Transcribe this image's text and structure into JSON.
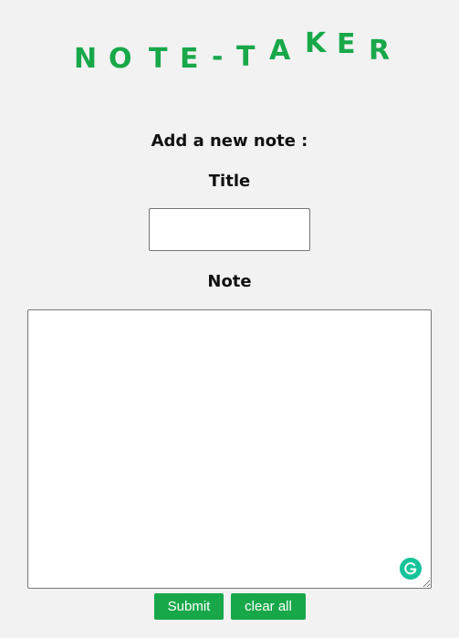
{
  "app": {
    "logo_letters": [
      "N",
      "O",
      "T",
      "E",
      "-",
      "T",
      "A",
      "K",
      "E",
      "R"
    ]
  },
  "form": {
    "heading": "Add a new note :",
    "title_label": "Title",
    "title_value": "",
    "note_label": "Note",
    "note_value": ""
  },
  "buttons": {
    "submit_label": "Submit",
    "clear_label": "clear all"
  },
  "icons": {
    "grammarly": "grammarly-icon"
  },
  "colors": {
    "accent": "#18a84a",
    "background": "#f2f2f2",
    "grammarly": "#15c39a"
  }
}
